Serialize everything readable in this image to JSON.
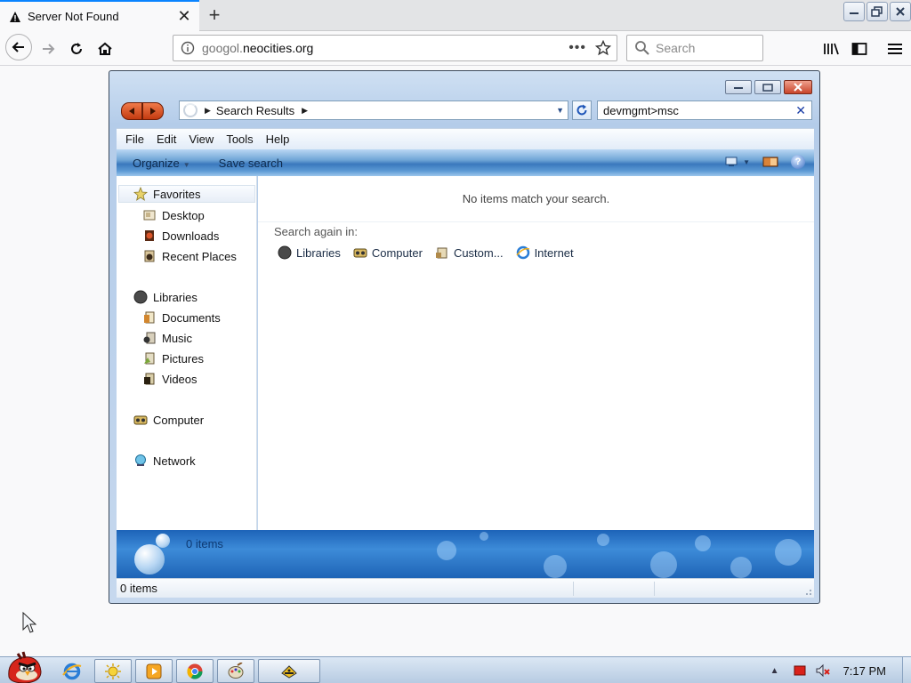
{
  "browser": {
    "tab": {
      "title": "Server Not Found"
    },
    "url": {
      "domain_prefix": "googol.",
      "domain_main": "neocities.org"
    },
    "search": {
      "placeholder": "Search"
    }
  },
  "explorer": {
    "breadcrumb": "Search Results",
    "search_value": "devmgmt>msc",
    "menu": [
      "File",
      "Edit",
      "View",
      "Tools",
      "Help"
    ],
    "commands": {
      "organize": "Organize",
      "save_search": "Save search"
    },
    "nav": {
      "favorites": "Favorites",
      "desktop": "Desktop",
      "downloads": "Downloads",
      "recent_places": "Recent Places",
      "libraries": "Libraries",
      "documents": "Documents",
      "music": "Music",
      "pictures": "Pictures",
      "videos": "Videos",
      "computer": "Computer",
      "network": "Network"
    },
    "content": {
      "no_match": "No items match your search.",
      "search_again": "Search again in:",
      "locations": {
        "libraries": "Libraries",
        "computer": "Computer",
        "custom": "Custom...",
        "internet": "Internet"
      }
    },
    "detail_count": "0 items",
    "status_count": "0 items"
  },
  "taskbar": {
    "clock": "7:17 PM"
  },
  "colors": {
    "tab_accent": "#0a84ff",
    "cmdbar": "#3a78bd",
    "detail_pane": "#1d63b8"
  }
}
